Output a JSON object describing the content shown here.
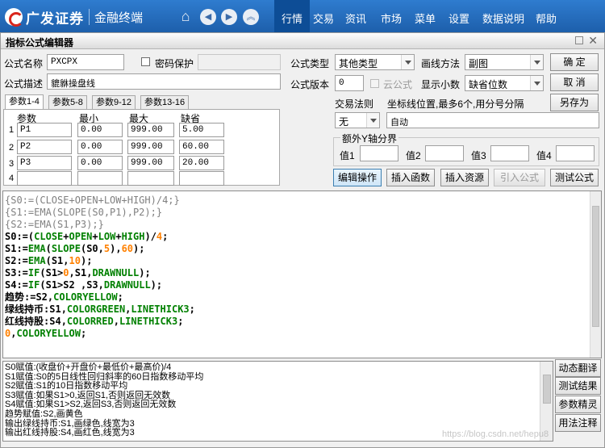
{
  "app": {
    "brand": "广发证券",
    "product": "金融终端",
    "menu": [
      "行情",
      "交易",
      "资讯",
      "市场",
      "菜单",
      "设置",
      "数据说明",
      "帮助"
    ],
    "active_menu": "行情"
  },
  "dialog": {
    "title": "指标公式编辑器",
    "formula_name_label": "公式名称",
    "formula_name": "PXCPX",
    "password_label": "密码保护",
    "formula_desc_label": "公式描述",
    "formula_desc": "貔貅操盘线",
    "formula_type_label": "公式类型",
    "formula_type": "其他类型",
    "draw_method_label": "画线方法",
    "draw_method": "副图",
    "version_label": "公式版本",
    "version": "0",
    "cloud_label": "云公式",
    "decimals_label": "显示小数",
    "decimals": "缺省位数",
    "trade_rule_label": "交易法则",
    "trade_rule": "无",
    "coord_label": "坐标线位置,最多6个,用分号分隔",
    "coord_value": "自动",
    "yaxis_label": "额外Y轴分界",
    "yaxis_values": [
      "值1",
      "值2",
      "值3",
      "值4"
    ],
    "buttons": {
      "ok": "确  定",
      "cancel": "取  消",
      "save_as": "另存为",
      "edit_op": "编辑操作",
      "insert_func": "插入函数",
      "insert_res": "插入资源",
      "import_formula": "引入公式",
      "test_formula": "测试公式",
      "dynamic_translate": "动态翻译",
      "test_result": "测试结果",
      "param_wizard": "参数精灵",
      "usage_notes": "用法注释"
    },
    "param_tabs": [
      "参数1-4",
      "参数5-8",
      "参数9-12",
      "参数13-16"
    ],
    "param_headers": [
      "参数",
      "最小",
      "最大",
      "缺省"
    ],
    "params": [
      {
        "idx": "1",
        "name": "P1",
        "min": "0.00",
        "max": "999.00",
        "def": "5.00"
      },
      {
        "idx": "2",
        "name": "P2",
        "min": "0.00",
        "max": "999.00",
        "def": "60.00"
      },
      {
        "idx": "3",
        "name": "P3",
        "min": "0.00",
        "max": "999.00",
        "def": "20.00"
      },
      {
        "idx": "4",
        "name": "",
        "min": "",
        "max": "",
        "def": ""
      }
    ]
  },
  "code_lines": [
    "{S0:=(CLOSE+OPEN+LOW+HIGH)/4;}",
    "{S1:=EMA(SLOPE(S0,P1),P2);}",
    "{S2:=EMA(S1,P3);}",
    "S0:=(CLOSE+OPEN+LOW+HIGH)/4;",
    "S1:=EMA(SLOPE(S0,5),60);",
    "S2:=EMA(S1,10);",
    "S3:=IF(S1>0,S1,DRAWNULL);",
    "S4:=IF(S1>S2 ,S3,DRAWNULL);",
    "趋势:=S2,COLORYELLOW;",
    "绿线持币:S1,COLORGREEN,LINETHICK3;",
    "红线持股:S4,COLORRED,LINETHICK3;",
    "0,COLORYELLOW;"
  ],
  "desc_lines": [
    "S0赋值:(收盘价+开盘价+最低价+最高价)/4",
    "S1赋值:S0的5日线性回归斜率的60日指数移动平均",
    "S2赋值:S1的10日指数移动平均",
    "S3赋值:如果S1>0,返回S1,否则返回无效数",
    "S4赋值:如果S1>S2,返回S3,否则返回无效数",
    "趋势赋值:S2,画黄色",
    "输出绿线持币:S1,画绿色,线宽为3",
    "输出红线持股:S4,画红色,线宽为3"
  ],
  "watermark": "https://blog.csdn.net/hepu8"
}
